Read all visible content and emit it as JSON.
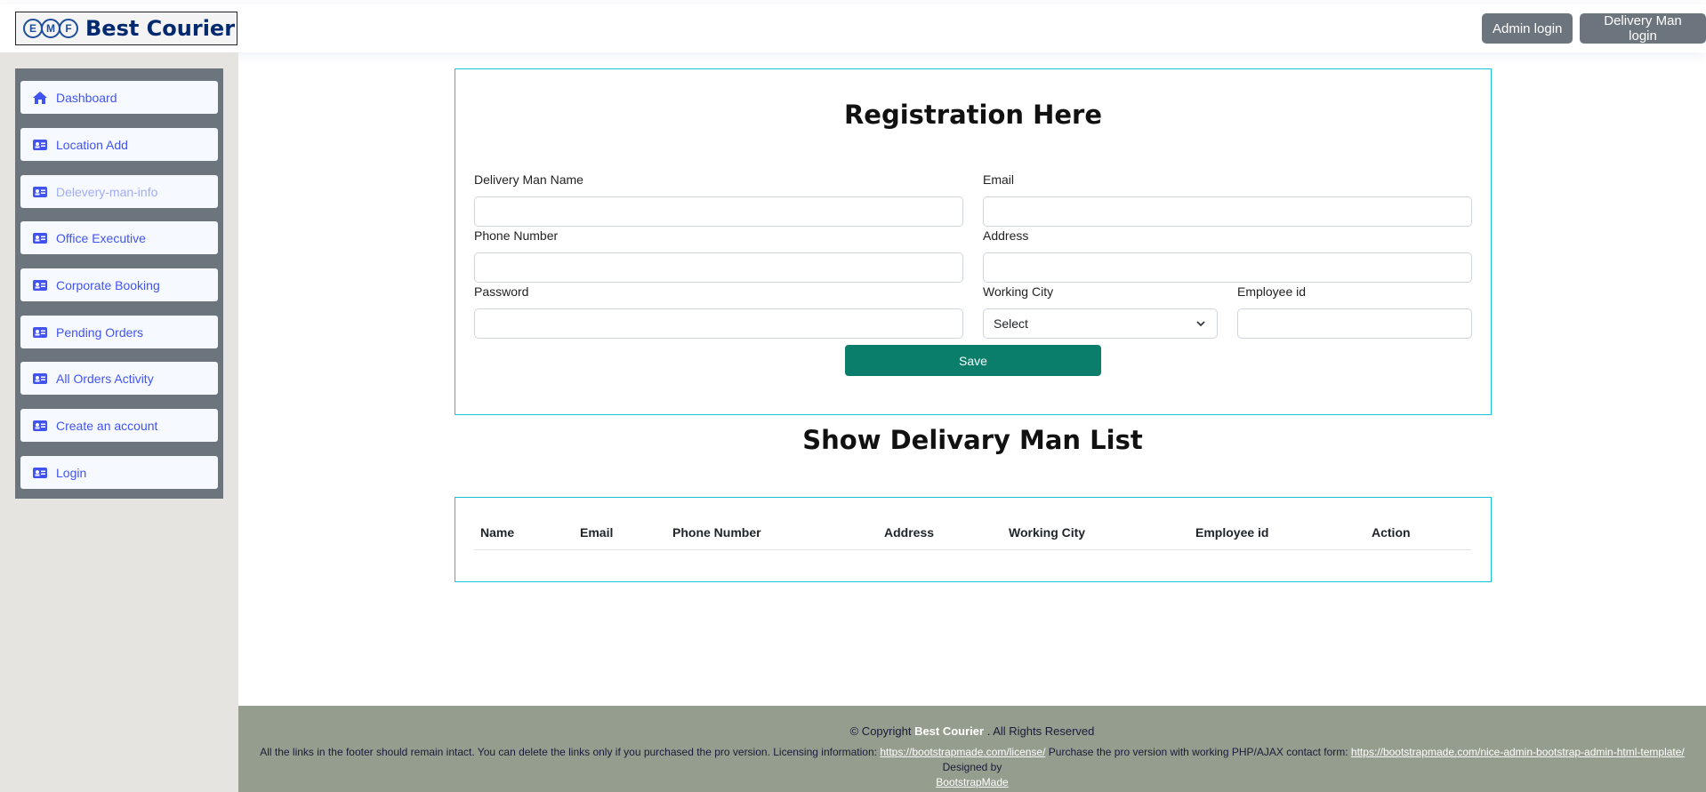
{
  "header": {
    "logo_letters": [
      "E",
      "M",
      "F"
    ],
    "brand": "Best Courier",
    "admin_login": "Admin login",
    "delivery_login": "Delivery Man login"
  },
  "sidebar": {
    "items": [
      {
        "label": "Dashboard",
        "icon": "house-icon"
      },
      {
        "label": "Location Add",
        "icon": "card-icon"
      },
      {
        "label": "Delevery-man-info",
        "icon": "card-icon"
      },
      {
        "label": "Office Executive",
        "icon": "card-icon"
      },
      {
        "label": "Corporate Booking",
        "icon": "card-icon"
      },
      {
        "label": "Pending Orders",
        "icon": "card-icon"
      },
      {
        "label": "All Orders Activity",
        "icon": "card-icon"
      },
      {
        "label": "Create an account",
        "icon": "card-icon"
      },
      {
        "label": "Login",
        "icon": "card-icon"
      }
    ]
  },
  "form": {
    "title": "Registration Here",
    "name_label": "Delivery Man Name",
    "email_label": "Email",
    "phone_label": "Phone Number",
    "address_label": "Address",
    "password_label": "Password",
    "city_label": "Working City",
    "city_value": "Select",
    "employee_label": "Employee id",
    "save": "Save"
  },
  "list": {
    "title": "Show Delivary Man List",
    "columns": [
      "Name",
      "Email",
      "Phone Number",
      "Address",
      "Working City",
      "Employee id",
      "Action"
    ]
  },
  "footer": {
    "copyright_prefix": "© Copyright",
    "brand": "Best Courier",
    "copyright_suffix": ". All Rights Reserved",
    "text1": "All the links in the footer should remain intact. You can delete the links only if you purchased the pro version. Licensing information:",
    "link1": "https://bootstrapmade.com/license/",
    "text2": "Purchase the pro version with working PHP/AJAX contact form:",
    "link2": "https://bootstrapmade.com/nice-admin-bootstrap-admin-html-template/",
    "text3": "Designed by",
    "link3": "BootstrapMade"
  },
  "colors": {
    "accent": "#4154f1",
    "sidebar_bg": "#6c757d",
    "save_button": "#0a7e6a",
    "panel_border": "#17c1d6",
    "footer_bg": "#959e8e"
  }
}
